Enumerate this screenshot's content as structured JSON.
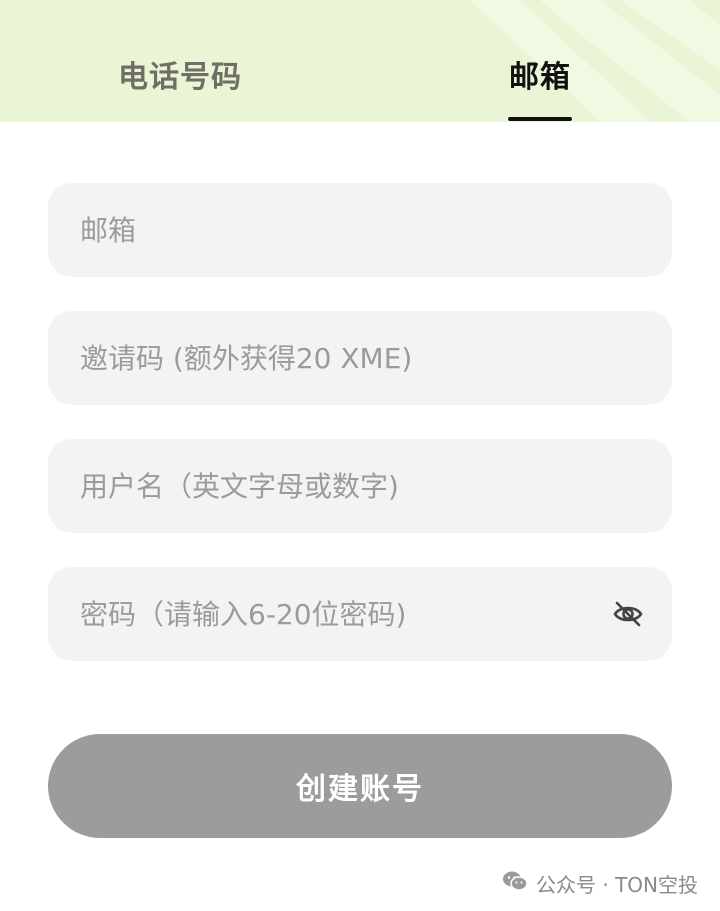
{
  "tabs": {
    "phone_label": "电话号码",
    "email_label": "邮箱",
    "active": "email"
  },
  "form": {
    "email_placeholder": "邮箱",
    "invite_placeholder": "邀请码 (额外获得20 XME)",
    "username_placeholder": "用户名（英文字母或数字)",
    "password_placeholder": "密码（请输入6-20位密码)",
    "password_toggle_icon": "eye-off-icon"
  },
  "create_button_label": "创建账号",
  "watermark": {
    "text": "公众号 · TON空投",
    "icon": "wechat-icon"
  },
  "colors": {
    "header_bg": "#eaf5d6",
    "active_tab": "#111111",
    "inactive_tab": "#6f6f67",
    "field_bg": "#f3f3f3",
    "button_bg": "#9c9c9c"
  }
}
